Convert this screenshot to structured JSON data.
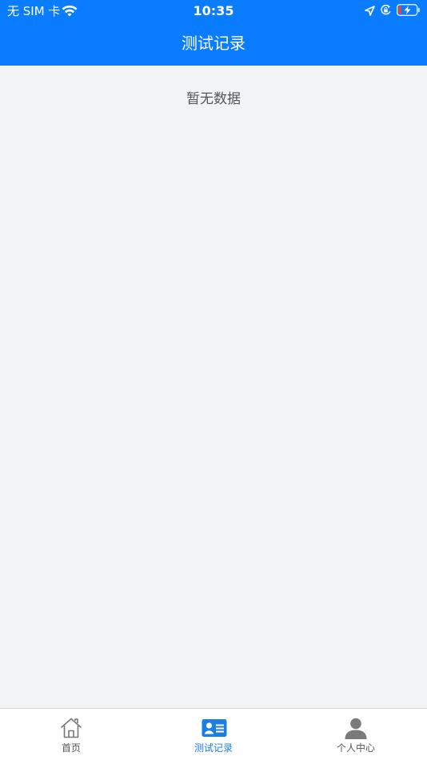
{
  "status_bar": {
    "carrier": "无 SIM 卡",
    "time": "10:35"
  },
  "header": {
    "title": "测试记录"
  },
  "main": {
    "empty_message": "暂无数据"
  },
  "tabbar": {
    "tabs": [
      {
        "label": "首页",
        "icon": "home-icon",
        "active": false
      },
      {
        "label": "测试记录",
        "icon": "id-card-icon",
        "active": true
      },
      {
        "label": "个人中心",
        "icon": "person-icon",
        "active": false
      }
    ]
  },
  "colors": {
    "primary": "#0a7cff",
    "background": "#f2f3f5",
    "tab_active": "#1a7ee6",
    "tab_inactive": "#555555",
    "battery_low": "#ff3b30"
  }
}
